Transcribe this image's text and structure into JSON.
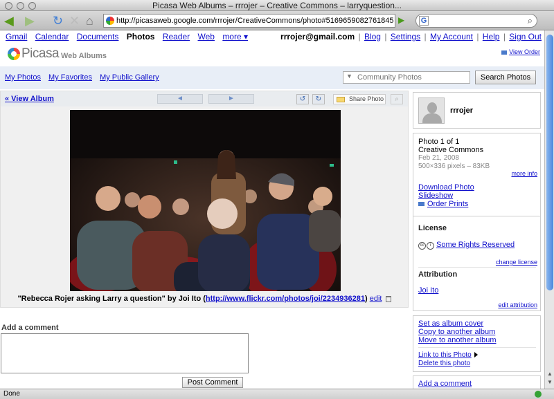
{
  "window": {
    "title": "Picasa Web Albums – rrrojer – Creative Commons – larryquestion..."
  },
  "browser": {
    "url": "http://picasaweb.google.com/rrrojer/CreativeCommons/photo#5169659082761845",
    "search_placeholder": "",
    "status": "Done"
  },
  "gbar": {
    "links": [
      "Gmail",
      "Calendar",
      "Documents",
      "Photos",
      "Reader",
      "Web",
      "more ▾"
    ],
    "user_email": "rrrojer@gmail.com",
    "right_links": [
      "Blog",
      "Settings",
      "My Account",
      "Help",
      "Sign Out"
    ]
  },
  "header": {
    "logo_text": "Picasa",
    "logo_sub": "Web Albums",
    "view_order": "View Order"
  },
  "nav": {
    "links": [
      "My Photos",
      "My Favorites",
      "My Public Gallery"
    ],
    "search_placeholder": "Community Photos",
    "search_button": "Search Photos"
  },
  "photo_view": {
    "view_album": "« View Album",
    "prev_label": "◄",
    "next_label": "►",
    "share_label": "Share Photo",
    "caption": "\"Rebecca Rojer asking Larry a question\" by Joi Ito",
    "caption_url": "http://www.flickr.com/photos/joi/2234936281",
    "edit_label": "edit"
  },
  "comment": {
    "label": "Add a comment",
    "post_button": "Post Comment"
  },
  "sidebar": {
    "user": {
      "name": "rrrojer"
    },
    "info": {
      "count": "Photo 1 of 1",
      "album": "Creative Commons",
      "date": "Feb 21, 2008",
      "dims": "500×336 pixels – 83KB",
      "more_info": "more info",
      "download": "Download Photo",
      "slideshow": "Slideshow",
      "order": "Order Prints"
    },
    "license": {
      "title": "License",
      "text": "Some Rights Reserved",
      "change": "change license",
      "attr_title": "Attribution",
      "attr_name": "Joi Ito",
      "edit_attr": "edit attribution"
    },
    "actions": {
      "cover": "Set as album cover",
      "copy": "Copy to another album",
      "move": "Move to another album",
      "link": "Link to this Photo",
      "delete": "Delete this photo"
    },
    "add_comment": "Add a comment"
  },
  "colors": {
    "link": "#1111cc",
    "nav_bg": "#e8eef7",
    "scroll_thumb": "#4b88dd"
  }
}
